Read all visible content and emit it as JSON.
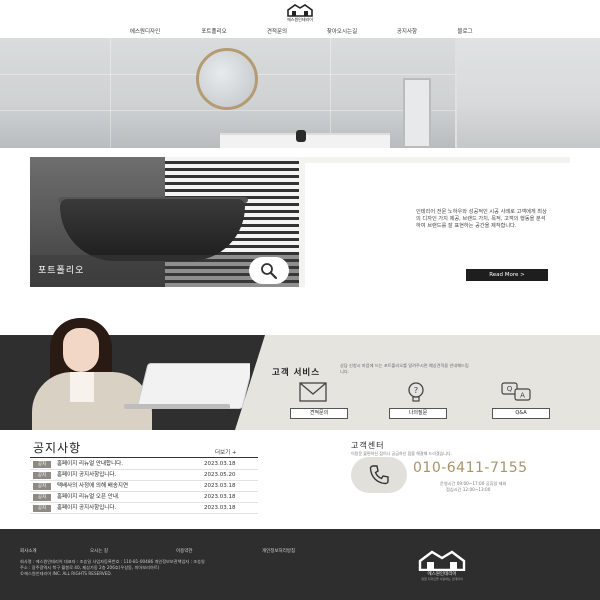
{
  "header": {
    "logo_text": "에스원인테리어",
    "nav": [
      "에스원디자인",
      "포트폴리오",
      "견적문의",
      "찾아오시는길",
      "공지사항",
      "블로그"
    ]
  },
  "portfolio": {
    "label": "포트폴리오",
    "description": "인테리어 전문 노하우와 성공적인 시공 사례로 고객에게 최상의 디자인 가치 제공, 브랜드 가치, 목적, 고객의 행동을 분석하여 브랜드를 잘 표현하는 공간을 제작합니다.",
    "more_button": "Read More >"
  },
  "customer_service": {
    "title": "고객 서비스",
    "subtitle": "상담 신청시 마음에 드는 포트폴리오를 알려주시면 예상견적을 안내해드립니다.",
    "buttons": [
      {
        "label": "견적문의",
        "icon": "envelope-icon"
      },
      {
        "label": "나의질문",
        "icon": "lightbulb-question-icon"
      },
      {
        "label": "Q&A",
        "icon": "qa-bubbles-icon"
      }
    ]
  },
  "notices": {
    "title": "공지사항",
    "more": "더보기 +",
    "badge": "공지",
    "items": [
      {
        "title": "홈페이지 리뉴얼 안내합니다.",
        "date": "2023.03.18"
      },
      {
        "title": "홈페이지 공지사항입니다.",
        "date": "2023.05.20"
      },
      {
        "title": "택배사의 사정에 의해 배송지연",
        "date": "2023.03.18"
      },
      {
        "title": "홈페이지 리뉴얼 오픈 안내.",
        "date": "2023.03.18"
      },
      {
        "title": "홈페이지 공지사항입니다.",
        "date": "2023.03.18"
      }
    ]
  },
  "customer_center": {
    "title": "고객센터",
    "subtitle": "이용문 불편하신 점이나 궁금하신 점을 해결해 드리겠습니다.",
    "phone": "010-6411-7155",
    "hours_weekday": "운영시간 09:00~17:00 공휴일 제외",
    "hours_lunch": "점심시간 12:00~13:00"
  },
  "footer": {
    "links": [
      "회사소개",
      "오시는 길",
      "이용약관",
      "개인정보처리방침"
    ],
    "line1": "회사명 : 에스원인테리어 대표자 : 조승일 사업자등록번호 : 110-81-00486 개인정보보관책임자 : 조승일",
    "line2": "주소 : 광주광역시 북구 월봉로 40, 제상가동 2층 206호(우성동, 미아보리아트)",
    "line3": "©에스원인테리어 INC. ALL RIGHTS RESERVED.",
    "logo_text": "에스원인테리어",
    "logo_sub": "유럽 디자인을 사랑하는 인테리어"
  },
  "colors": {
    "accent_gold": "#a8936a",
    "dark": "#2e2e2e",
    "badge": "#8d8a84"
  }
}
